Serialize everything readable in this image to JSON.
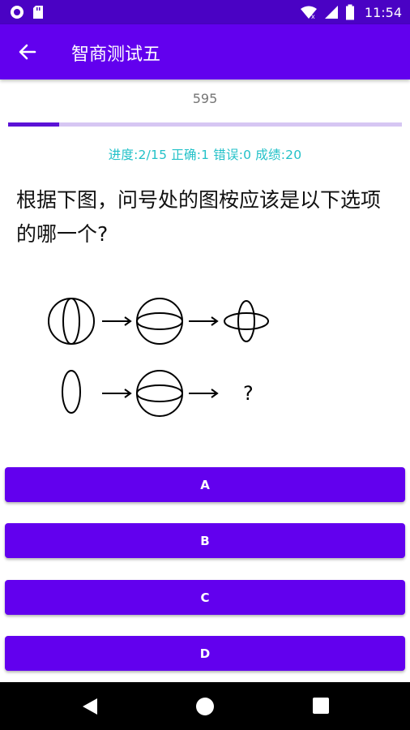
{
  "status_bar": {
    "time": "11:54",
    "icons": [
      "circle-notification-icon",
      "sd-card-icon",
      "wifi-icon",
      "signal-icon",
      "battery-icon"
    ]
  },
  "app_bar": {
    "title": "智商测试五",
    "back_icon": "arrow-left-icon"
  },
  "timer": "595",
  "progress": {
    "current": 2,
    "total": 15,
    "fraction": 0.13
  },
  "stats": "进度:2/15  正确:1 错误:0 成绩:20",
  "question": "根据下图，问号处的图桉应该是以下选项的哪一个?",
  "figure": {
    "question_mark": "?"
  },
  "options": [
    "A",
    "B",
    "C",
    "D"
  ],
  "colors": {
    "primary": "#6200ee",
    "status_bar": "#4a02c4",
    "accent_text": "#22c1c8",
    "progress_fill": "#5b12d6",
    "progress_track": "#d6c6f3"
  },
  "nav_bar": {
    "icons": [
      "back-triangle-icon",
      "home-circle-icon",
      "recents-square-icon"
    ]
  }
}
